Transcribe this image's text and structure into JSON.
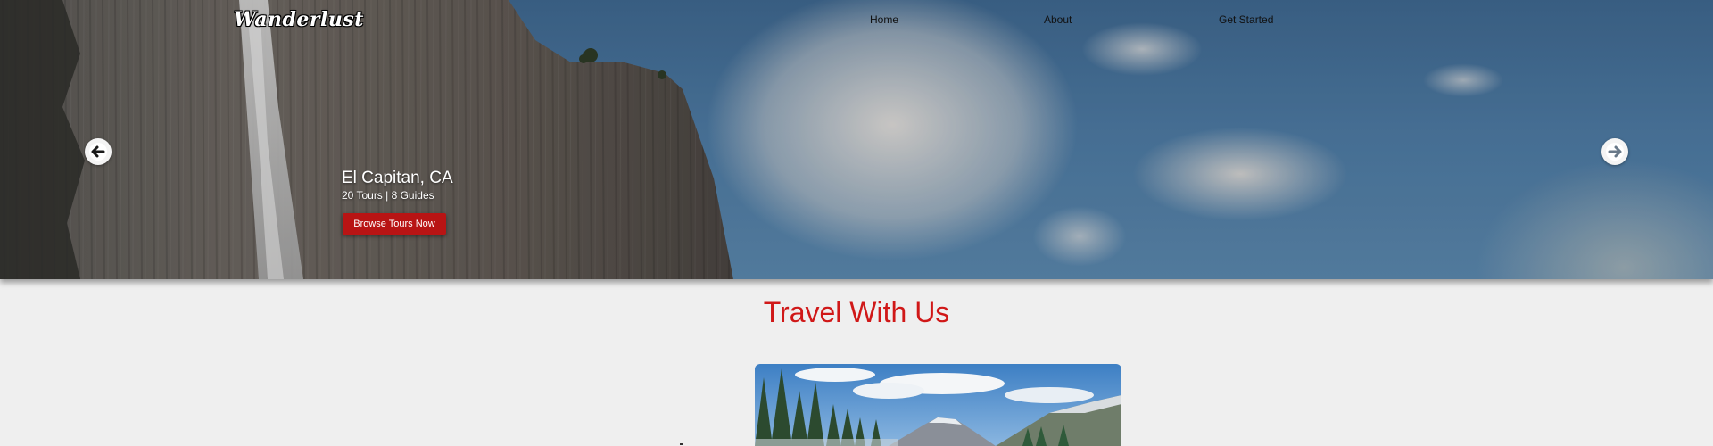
{
  "nav": {
    "logo": "Wanderlust",
    "links": [
      "Home",
      "About",
      "Get Started"
    ]
  },
  "hero": {
    "title": "El Capitan, CA",
    "subtitle": "20 Tours | 8 Guides",
    "button_label": "Browse Tours Now",
    "prev_icon": "arrow-left-icon",
    "next_icon": "arrow-right-icon"
  },
  "section": {
    "title": "Travel With Us"
  },
  "colors": {
    "accent": "#b81414",
    "heading": "#d01818",
    "background": "#efefef"
  }
}
